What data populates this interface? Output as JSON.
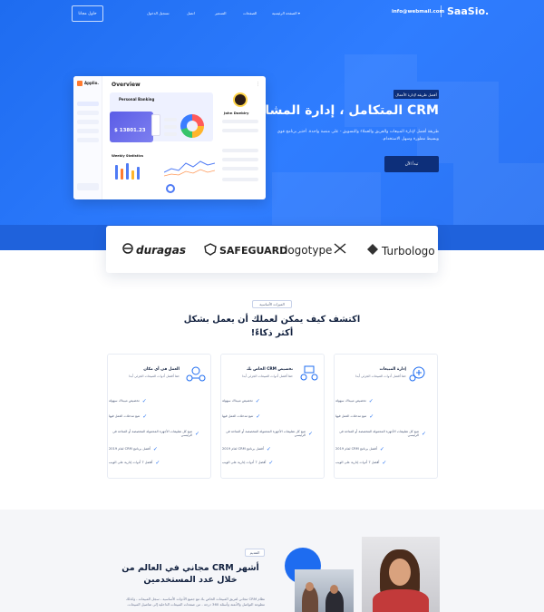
{
  "nav": {
    "brand": "SaaSio.",
    "email": "info@webmail.com",
    "items": [
      "الصفحة الرئيسية ▾",
      "الصفحات",
      "التسعير",
      "اتصل",
      "تسجيل الدخول"
    ],
    "login_button": "حاول مجانا"
  },
  "hero": {
    "badge": "أفضل طريقة لإدارة الأعمال",
    "title": "CRM المتكامل ، إدارة المشاريع",
    "description": "طريقة أفضل لإدارة المبيعات والفريق والعملاء والتسويق - على منصة واحدة. أختبر برنامج قوي وبسيط مطورة وسهل الاستخدام.",
    "cta": "تبدأ الآن"
  },
  "dashboard": {
    "app_name": "Applio.",
    "title": "Overview",
    "personal_banking": "Personal Banking",
    "card_amount": "$ 13801.23",
    "profile_name": "John Doeblry",
    "weekly_statistics": "Weekly Statistics"
  },
  "partners": {
    "logos": [
      "duragas",
      "SAFEGUARD",
      "logotype",
      "Turbologo"
    ]
  },
  "features": {
    "badge": "الميزات الأساسية",
    "title": "اكتشف كيف يمكن لعملك أن يعمل بشكل أكثر ذكاءً!",
    "cards": [
      {
        "title": "إدارة المبيعات",
        "subtitle": "حقا أفضل أدوات المبيعات الجزئي أبدا",
        "items": [
          "تخصيص مبيداك سهولة",
          "تتبع مدخلات العمل فيها",
          "تتبع كل تطبيقات الأجهزة المحمولة المخصصة أو المتاحة في الرئيسي",
          "أفضل برنامج CRM لعام 2019",
          "أفضل 7 أدوات إدارية على الويب"
        ]
      },
      {
        "title": "تخصيص CRM الخاص بك",
        "subtitle": "حقا أفضل أدوات المبيعات الجزئي أبدا",
        "items": [
          "تخصيص مبيداك سهولة",
          "تتبع مدخلات العمل فيها",
          "تتبع كل تطبيقات الأجهزة المحمولة المخصصة أو المتاحة في الرئيسي",
          "أفضل برنامج CRM لعام 2019",
          "أفضل 7 أدوات إدارية على الويب"
        ]
      },
      {
        "title": "العمل في أي مكان",
        "subtitle": "حقا أفضل أدوات المبيعات الجزئي أبدا",
        "items": [
          "تخصيص مبيداك سهولة",
          "تتبع مدخلات العمل فيها",
          "تتبع كل تطبيقات الأجهزة المحمولة المخصصة أو المتاحة في الرئيسي",
          "أفضل برنامج CRM لعام 2019",
          "أفضل 7 أدوات إدارية على الويب"
        ]
      }
    ]
  },
  "about": {
    "badge": "التقديم",
    "title": "أشهر CRM مجاني في العالم من خلال عدد المستخدمين",
    "description": "نظام CRM مجاني لفريق المبيعات الخاص بك مع جميع الأدوات الأساسية - سجل المبيعات ، وكذلك مطوعة التواصل والأتمتة وأسئلة 360 درجة - من صفحات المبيعات الداخلية إلى تفاصيل المبيعات."
  },
  "colors": {
    "primary": "#1e6cf0",
    "navy": "#0d2f7a"
  }
}
